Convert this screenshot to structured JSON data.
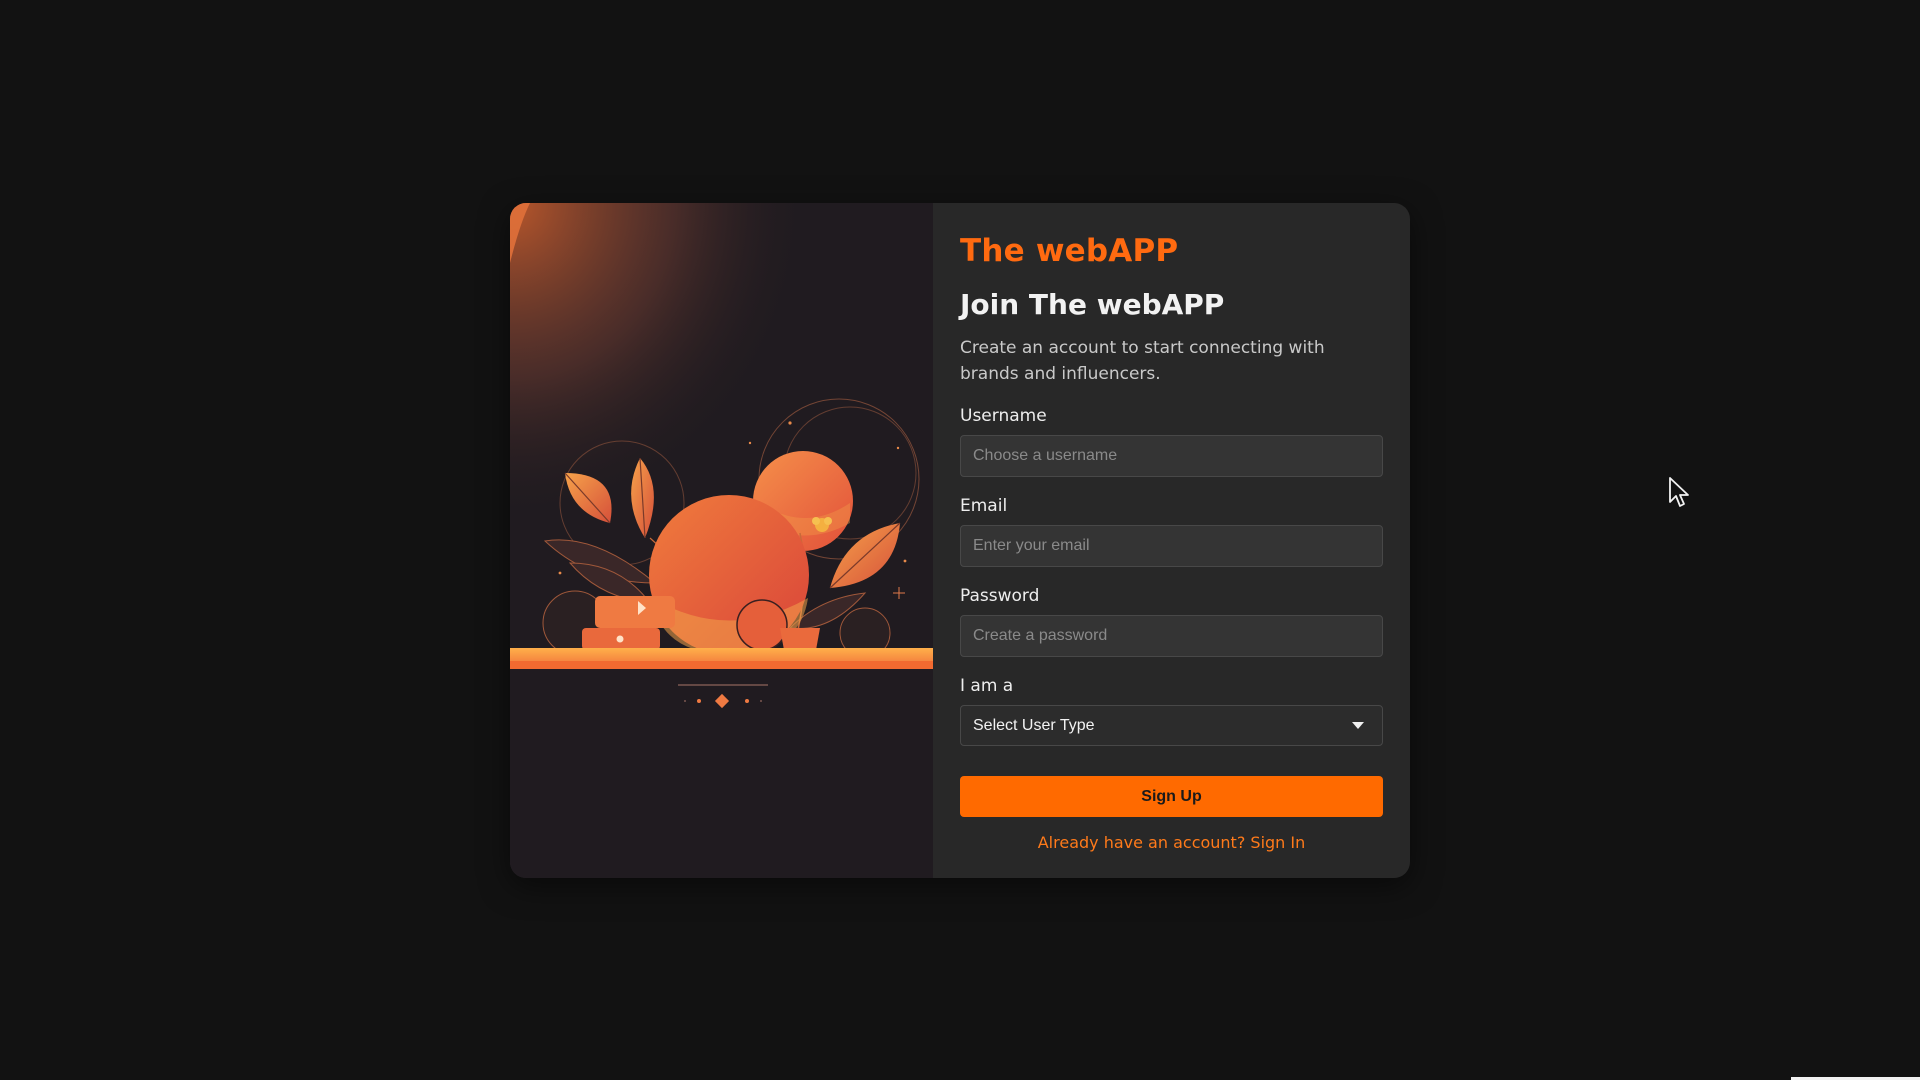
{
  "app": {
    "brand": "The webAPP"
  },
  "signup": {
    "heading": "Join The webAPP",
    "subtitle": "Create an account to start connecting with brands and influencers.",
    "username": {
      "label": "Username",
      "placeholder": "Choose a username",
      "value": ""
    },
    "email": {
      "label": "Email",
      "placeholder": "Enter your email",
      "value": ""
    },
    "password": {
      "label": "Password",
      "placeholder": "Create a password",
      "value": ""
    },
    "user_type": {
      "label": "I am a",
      "selected": "Select User Type",
      "icon": "chevron-down-icon"
    },
    "submit_label": "Sign Up",
    "signin_link": "Already have an account? Sign In"
  },
  "colors": {
    "accent": "#ff6a00",
    "background": "#121212",
    "card": "#282828",
    "art_panel": "#201b20"
  },
  "illustration": {
    "icon": "abstract-botanical-illustration"
  }
}
